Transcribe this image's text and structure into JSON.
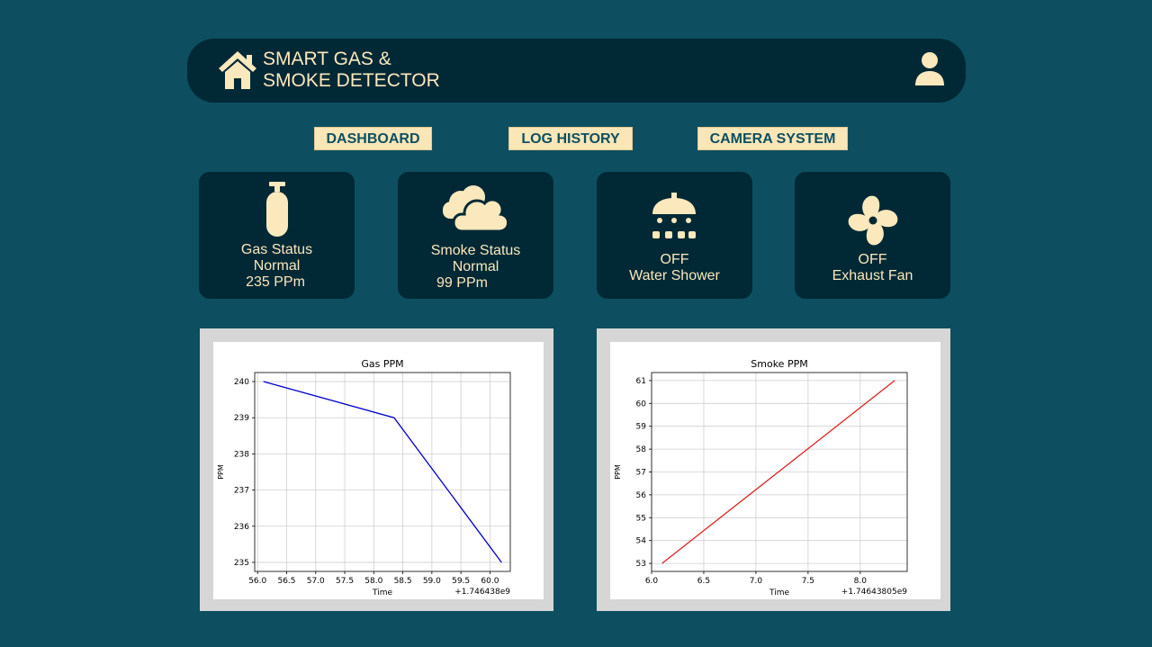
{
  "header": {
    "title_line1": "SMART GAS &",
    "title_line2": "SMOKE DETECTOR",
    "home_icon": "home-icon",
    "user_icon": "user-icon"
  },
  "nav": [
    {
      "label": "DASHBOARD"
    },
    {
      "label": "LOG HISTORY"
    },
    {
      "label": "CAMERA SYSTEM"
    }
  ],
  "cards": {
    "gas": {
      "icon": "gas-cylinder-icon",
      "title": "Gas Status",
      "status": "Normal",
      "reading": "235 PPm"
    },
    "smoke": {
      "icon": "cloud-icon",
      "title": "Smoke Status",
      "status": "Normal",
      "reading": "99 PPm"
    },
    "shower": {
      "icon": "shower-icon",
      "state": "OFF",
      "label": "Water Shower"
    },
    "fan": {
      "icon": "fan-icon",
      "state": "OFF",
      "label": "Exhaust Fan"
    }
  },
  "colors": {
    "background": "#0d4f60",
    "panel": "#002835",
    "accent": "#fbe8bd",
    "gas_line": "#0000cc",
    "smoke_line": "#dd2222"
  },
  "chart_data": [
    {
      "type": "line",
      "title": "Gas PPM",
      "xlabel": "Time",
      "ylabel": "PPM",
      "offset_label": "+1.746438e9",
      "xlim": [
        55.95,
        60.35
      ],
      "ylim": [
        234.75,
        240.25
      ],
      "xticks": [
        56.0,
        56.5,
        57.0,
        57.5,
        58.0,
        58.5,
        59.0,
        59.5,
        60.0
      ],
      "xtick_labels": [
        "56.0",
        "56.5",
        "57.0",
        "57.5",
        "58.0",
        "58.5",
        "59.0",
        "59.5",
        "60.0"
      ],
      "yticks": [
        235,
        236,
        237,
        238,
        239,
        240
      ],
      "ytick_labels": [
        "235",
        "236",
        "237",
        "238",
        "239",
        "240"
      ],
      "grid": true,
      "series": [
        {
          "x": [
            56.1,
            58.35,
            60.2
          ],
          "y": [
            240,
            239,
            235
          ],
          "color": "#0000cc"
        }
      ]
    },
    {
      "type": "line",
      "title": "Smoke PPM",
      "xlabel": "Time",
      "ylabel": "PPM",
      "offset_label": "+1.74643805e9",
      "xlim": [
        6.0,
        8.45
      ],
      "ylim": [
        52.65,
        61.35
      ],
      "xticks": [
        6.0,
        6.5,
        7.0,
        7.5,
        8.0
      ],
      "xtick_labels": [
        "6.0",
        "6.5",
        "7.0",
        "7.5",
        "8.0"
      ],
      "yticks": [
        53,
        54,
        55,
        56,
        57,
        58,
        59,
        60,
        61
      ],
      "ytick_labels": [
        "53",
        "54",
        "55",
        "56",
        "57",
        "58",
        "59",
        "60",
        "61"
      ],
      "grid": true,
      "series": [
        {
          "x": [
            6.1,
            8.33
          ],
          "y": [
            53,
            61
          ],
          "color": "#dd2222"
        }
      ]
    }
  ]
}
